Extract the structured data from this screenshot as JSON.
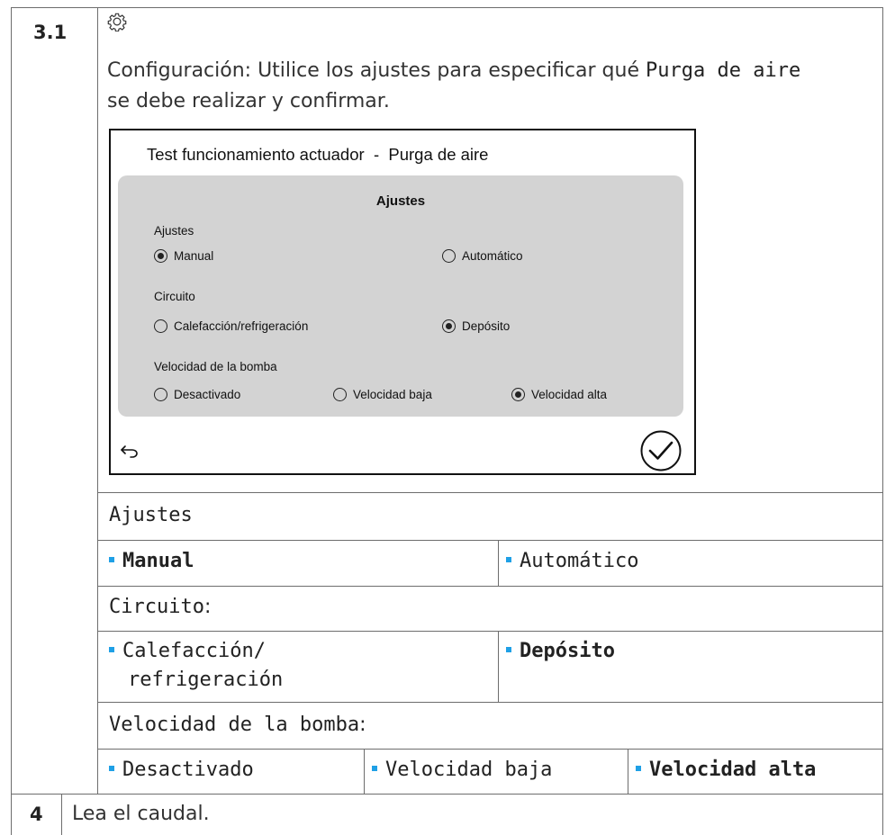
{
  "step_3_1": {
    "number": "3.1",
    "icon": "gear-icon",
    "instruction_prefix": "Configuración: Utilice los ajustes para especificar qué ",
    "instruction_code": "Purga de aire",
    "instruction_line2": "se debe realizar y confirmar."
  },
  "screen": {
    "title": "Test funcionamiento actuador  -  Purga de aire",
    "panel_title": "Ajustes",
    "groups": {
      "ajustes": {
        "label": "Ajustes",
        "options": [
          {
            "label": "Manual",
            "selected": true
          },
          {
            "label": "Automático",
            "selected": false
          }
        ]
      },
      "circuito": {
        "label": "Circuito",
        "options": [
          {
            "label": "Calefacción/refrigeración",
            "selected": false
          },
          {
            "label": "Depósito",
            "selected": true
          }
        ]
      },
      "velocidad": {
        "label": "Velocidad de la bomba",
        "options": [
          {
            "label": "Desactivado",
            "selected": false
          },
          {
            "label": "Velocidad baja",
            "selected": false
          },
          {
            "label": "Velocidad alta",
            "selected": true
          }
        ]
      }
    },
    "back_icon": "back-arrow-icon",
    "confirm_icon": "check-circle-icon"
  },
  "table": {
    "ajustes_header": "Ajustes",
    "ajustes_opt1": "Manual",
    "ajustes_opt2": "Automático",
    "circuito_header": "Circuito",
    "circuito_opt1_line1": "Calefacción/",
    "circuito_opt1_line2": "refrigeración",
    "circuito_opt2": "Depósito",
    "velocidad_header": "Velocidad de la bomba",
    "velocidad_opt1": "Desactivado",
    "velocidad_opt2": "Velocidad baja",
    "velocidad_opt3": "Velocidad alta",
    "colon": ":",
    "accent_color": "#1fa0e6"
  },
  "step_4": {
    "number": "4",
    "text": "Lea el caudal."
  }
}
